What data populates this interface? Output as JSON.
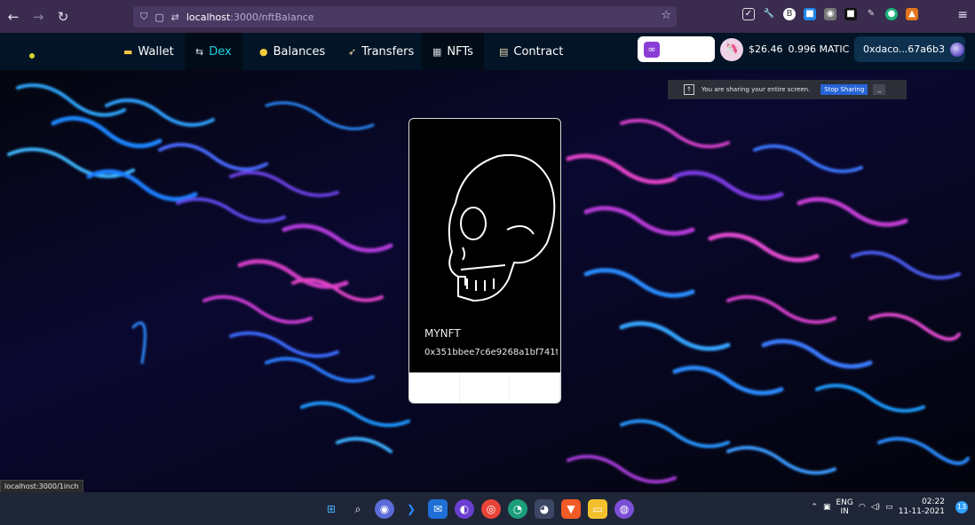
{
  "browser": {
    "url_host": "localhost",
    "url_path": ":3000/nftBalance"
  },
  "nav": {
    "items": [
      {
        "label": "Wallet",
        "icon": "wallet-icon"
      },
      {
        "label": "Dex",
        "icon": "swap-icon",
        "active": true
      },
      {
        "label": "Balances",
        "icon": "coin-icon"
      },
      {
        "label": "Transfers",
        "icon": "rocket-icon"
      },
      {
        "label": "NFTs",
        "icon": "picture-icon"
      },
      {
        "label": "Contract",
        "icon": "scroll-icon"
      }
    ],
    "balance_usd": "$26.46",
    "balance_token": "0.996 MATIC",
    "account": "0xdaco...67a6b3"
  },
  "share_banner": {
    "message": "You are sharing your entire screen.",
    "stop_label": "Stop Sharing"
  },
  "nft_card": {
    "name": "MYNFT",
    "address": "0x351bbee7c6e9268a1bf741t"
  },
  "status_link": "localhost:3000/1inch",
  "taskbar": {
    "lang_top": "ENG",
    "lang_bottom": "IN",
    "time": "02:22",
    "date": "11-11-2021",
    "notification_count": "13"
  },
  "colors": {
    "accent": "#1ad0e0",
    "nav_bg": "#021426",
    "browser_bg": "#3a2b4f"
  }
}
